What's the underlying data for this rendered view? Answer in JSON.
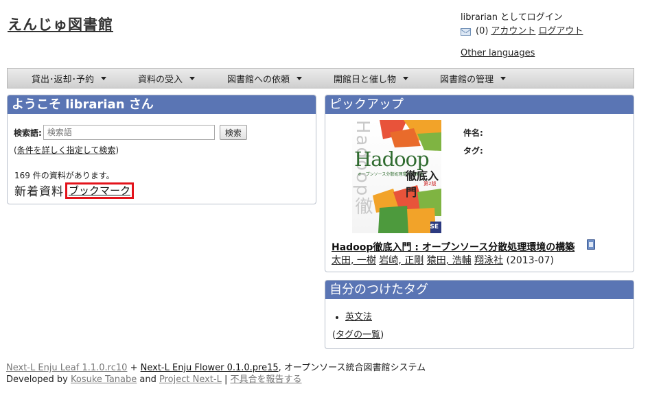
{
  "site": {
    "title": "えんじゅ図書館"
  },
  "login": {
    "status": "librarian としてログイン",
    "message_count": "(0)",
    "account_link": "アカウント",
    "logout_link": "ログアウト",
    "other_languages": "Other languages"
  },
  "menu": {
    "items": [
      {
        "label": "貸出･返却･予約"
      },
      {
        "label": "資料の受入"
      },
      {
        "label": "図書館への依頼"
      },
      {
        "label": "開館日と催し物"
      },
      {
        "label": "図書館の管理"
      }
    ]
  },
  "welcome": {
    "heading": "ようこそ librarian さん",
    "search_label": "検索語:",
    "search_placeholder": "検索語",
    "search_button": "検索",
    "advanced_open": "(",
    "advanced_link": "条件を詳しく指定して検索",
    "advanced_close": ")",
    "count_text": "169 件の資料があります。",
    "tab_new": "新着資料",
    "tab_bookmark": "ブックマーク"
  },
  "pickup": {
    "heading": "ピックアップ",
    "cover_spine": "Hadoop徹底入門",
    "cover_title_en": "Hadoop",
    "cover_subtitle": "オープンソース分散処理環境の構築",
    "cover_title_jp": "徹底入門",
    "cover_edition": "第2版",
    "cover_publisher": "SE",
    "label_title": "件名:",
    "label_tags": "タグ:",
    "book_title": "Hadoop徹底入門 : オープンソース分散処理環境の構築",
    "authors": [
      "太田, 一樹",
      "岩崎, 正剛",
      "猿田, 浩輔",
      "翔泳社"
    ],
    "year": "(2013-07)"
  },
  "my_tags": {
    "heading": "自分のつけたタグ",
    "tags": [
      "英文法"
    ],
    "all_open": "(",
    "all_link": "タグの一覧",
    "all_close": ")"
  },
  "footer": {
    "leaf_link": "Next-L Enju Leaf 1.1.0.rc10",
    "plus": "+",
    "flower_link": "Next-L Enju Flower 0.1.0.pre15",
    "system_text": ", オープンソース統合図書館システム",
    "developed_by": "Developed by",
    "developer_link": "Kosuke Tanabe",
    "and": "and",
    "project_link": "Project Next-L",
    "sep": "|",
    "report_link": "不具合を報告する"
  },
  "colors": {
    "panel_header": "#5a75b4",
    "highlight_border": "#e3131b"
  }
}
